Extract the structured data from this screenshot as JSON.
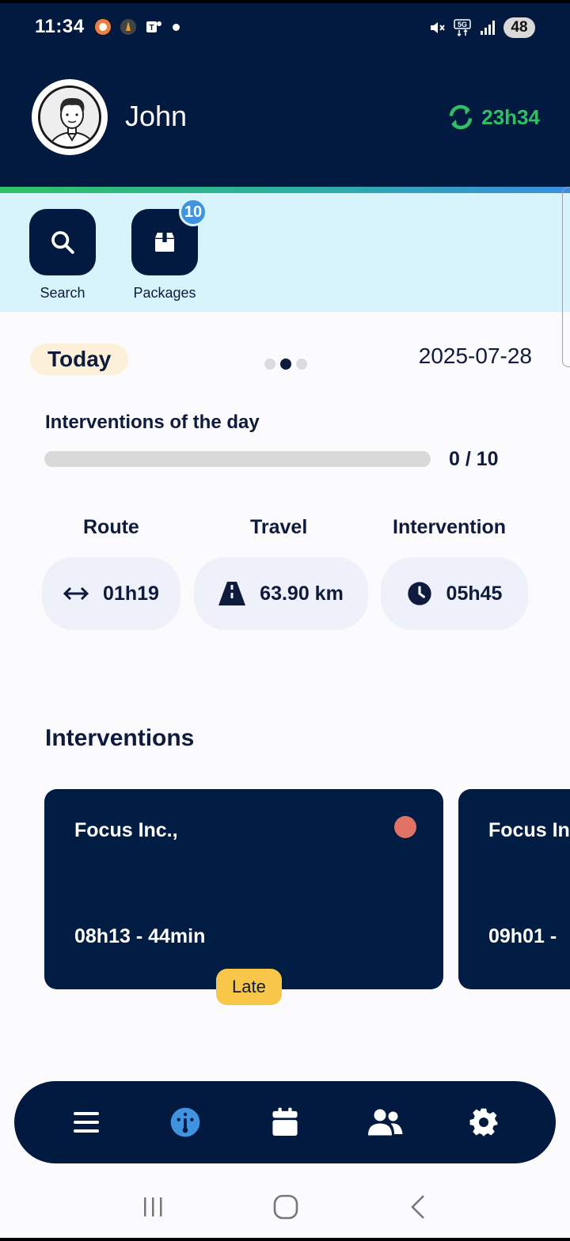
{
  "status_bar": {
    "time": "11:34",
    "battery": "48",
    "network": "5G"
  },
  "header": {
    "user_name": "John",
    "sync_time": "23h34"
  },
  "quick_actions": [
    {
      "label": "Search",
      "icon": "search-icon"
    },
    {
      "label": "Packages",
      "icon": "box-icon",
      "badge": "10"
    }
  ],
  "summary": {
    "period_label": "Today",
    "date": "2025-07-28",
    "interventions_title": "Interventions of the day",
    "progress_text": "0 / 10",
    "progress_fraction": 0,
    "stats": [
      {
        "header": "Route",
        "value": "01h19",
        "icon": "left-right-arrow-icon"
      },
      {
        "header": "Travel",
        "value": "63.90 km",
        "icon": "road-icon"
      },
      {
        "header": "Intervention",
        "value": "05h45",
        "icon": "clock-icon"
      }
    ]
  },
  "interventions": {
    "title": "Interventions",
    "cards": [
      {
        "company": "Focus Inc.,",
        "time": "08h13 - 44min",
        "status": "Late",
        "status_dot_color": "#e07266"
      },
      {
        "company": "Focus In",
        "time": "09h01 -"
      }
    ]
  },
  "bottom_nav": [
    {
      "icon": "menu-icon"
    },
    {
      "icon": "dashboard-icon",
      "active": true
    },
    {
      "icon": "calendar-icon"
    },
    {
      "icon": "team-icon"
    },
    {
      "icon": "settings-icon"
    }
  ],
  "colors": {
    "primary": "#031a40",
    "accent_green": "#2fc267",
    "badge_blue": "#3f93e0",
    "late_yellow": "#f8c74a",
    "quick_bg": "#d7f3fb"
  }
}
